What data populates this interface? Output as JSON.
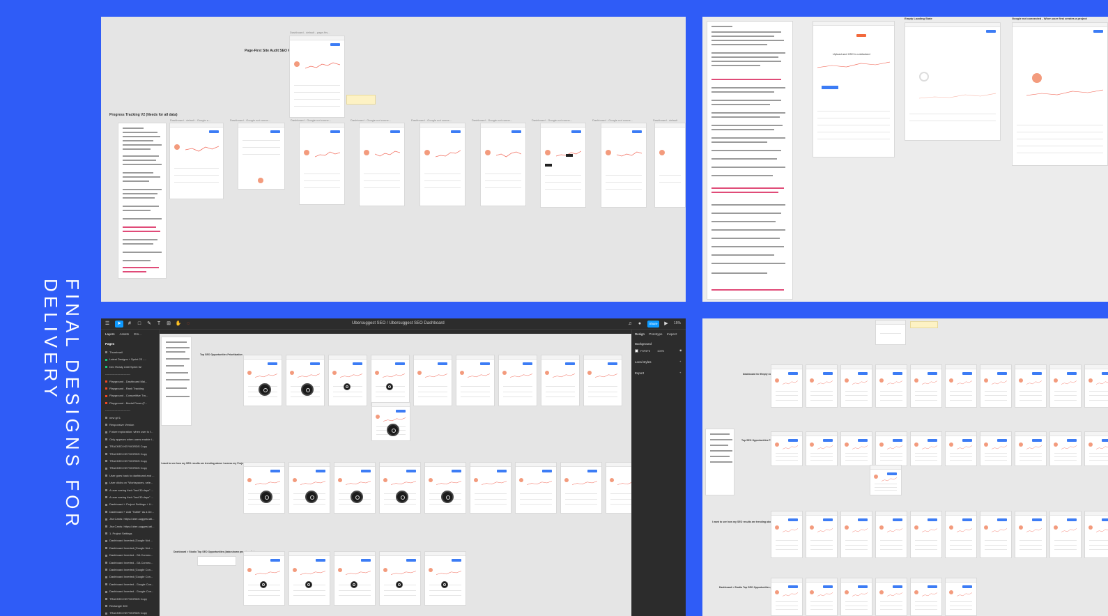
{
  "side_title": "FINAL DESIGNS FOR DELIVERY",
  "colors": {
    "background": "#2f5cf7",
    "figma_accent": "#0d99ff",
    "chart_line": "#f26b5b"
  },
  "panel_top_left": {
    "heading_site_audit": "Page-First Site Audit SEO Flows",
    "heading_progress": "Progress Tracking V2 (Needs for all data)",
    "frame_titles": [
      "Dashboard - default - page-firs...",
      "Dashboard - default - Google s...",
      "Dashboard - Google not conne...",
      "Dashboard - Google not conne...",
      "Dashboard - Google not conne...",
      "Dashboard - Google not conne...",
      "Dashboard - Google not conne...",
      "Dashboard - Google not conne...",
      "Dashboard - Google not conne...",
      "Dashboard - Google not conne...",
      "Dashboard - default"
    ]
  },
  "panel_top_right": {
    "frame_titles": [
      "Empty Loading State",
      "Google not connected - When user first creates a project"
    ],
    "subtitle_gsc": "Upload and GSC is unblocked"
  },
  "figma": {
    "file_breadcrumb": "Ubersuggest SEO / Ubersuggest SEO Dashboard",
    "share_label": "Share",
    "zoom_label": "15%",
    "left_tabs": [
      "Layers",
      "Assets",
      "Em..."
    ],
    "pages_header": "Pages",
    "layers": [
      {
        "label": "Thumbnail",
        "color": "#888888"
      },
      {
        "label": "Latest Designs + Sprint 23 -...",
        "color": "#1bc47d"
      },
      {
        "label": "Dev Ready Until Sprint 52",
        "color": "#1bc47d"
      },
      {
        "label": "---------------------------",
        "color": ""
      },
      {
        "label": "Playground - Dashboard Mai...",
        "color": "#f24822"
      },
      {
        "label": "Playground - Rank Tracking",
        "color": "#f24822"
      },
      {
        "label": "Playground - Competitive Tra...",
        "color": "#f24822"
      },
      {
        "label": "Playground - Modal Flows (F...",
        "color": "#f24822"
      },
      {
        "label": "---------------------------",
        "color": ""
      },
      {
        "label": "new gif 1",
        "color": "#888888"
      },
      {
        "label": "Responsive Version",
        "color": "#888888"
      },
      {
        "label": "Future exploration: when user is f...",
        "color": "#888888"
      },
      {
        "label": "Only appears when users enable t...",
        "color": "#888888"
      },
      {
        "label": "TRACKED KEYWORDS Copy",
        "color": "#888888"
      },
      {
        "label": "TRACKED KEYWORDS Copy",
        "color": "#888888"
      },
      {
        "label": "TRACKED KEYWORDS Copy",
        "color": "#888888"
      },
      {
        "label": "TRACKED KEYWORDS Copy",
        "color": "#888888"
      },
      {
        "label": "User goes back to dashboard and ...",
        "color": "#888888"
      },
      {
        "label": "User clicks on \"Workspaces, sele...",
        "color": "#888888"
      },
      {
        "label": "A user seeing their \"last 30 days\" ...",
        "color": "#888888"
      },
      {
        "label": "A user seeing their \"last 30 days\" ...",
        "color": "#888888"
      },
      {
        "label": "Dashboard + Project Settings + U...",
        "color": "#888888"
      },
      {
        "label": "Dashboard + Add \"Tablet\" as a De...",
        "color": "#888888"
      },
      {
        "label": "Jira Cards: https://uber-suggest.atl...",
        "color": "#888888"
      },
      {
        "label": "Jira Cards: https://uber-suggest.atl...",
        "color": "#888888"
      },
      {
        "label": "1. Project Settings",
        "color": "#888888"
      },
      {
        "label": "Dashboard Inverted (Google Not ...",
        "color": "#888888"
      },
      {
        "label": "Dashboard Inverted (Google Not ...",
        "color": "#888888"
      },
      {
        "label": "Dashboard Inverted - GA Connec...",
        "color": "#888888"
      },
      {
        "label": "Dashboard Inverted - GA Connec...",
        "color": "#888888"
      },
      {
        "label": "Dashboard Inverted (Google Con...",
        "color": "#888888"
      },
      {
        "label": "Dashboard Inverted (Google Con...",
        "color": "#888888"
      },
      {
        "label": "Dashboard Inverted - Google Con...",
        "color": "#888888"
      },
      {
        "label": "Dashboard Inverted - Google Con...",
        "color": "#888888"
      },
      {
        "label": "TRACKED KEYWORDS Copy",
        "color": "#888888"
      },
      {
        "label": "Rectangle 300",
        "color": "#888888"
      },
      {
        "label": "TRACKED KEYWORDS Copy",
        "color": "#888888"
      }
    ],
    "right_tabs": [
      "Design",
      "Prototype",
      "Inspect"
    ],
    "background_label": "Background",
    "background_hex": "F5F5F5",
    "background_opacity": "100%",
    "local_styles_label": "Local styles",
    "export_label": "Export",
    "canvas_headings": [
      "Top SEO Opportunities Prioritization",
      "I want to see how my SEO results are trending above / across my Project",
      "Dashboard > Studio Top SEO Opportunities (data shown prominently)"
    ]
  },
  "panel_bottom_right": {
    "headings": [
      "Dashboard for Empty state no...",
      "Top SEO Opportunities Prioritization",
      "I want to see how my SEO results are trending above / across my Project",
      "Dashboard > Studio Top SEO Opportunities (data shown prominently)"
    ]
  }
}
